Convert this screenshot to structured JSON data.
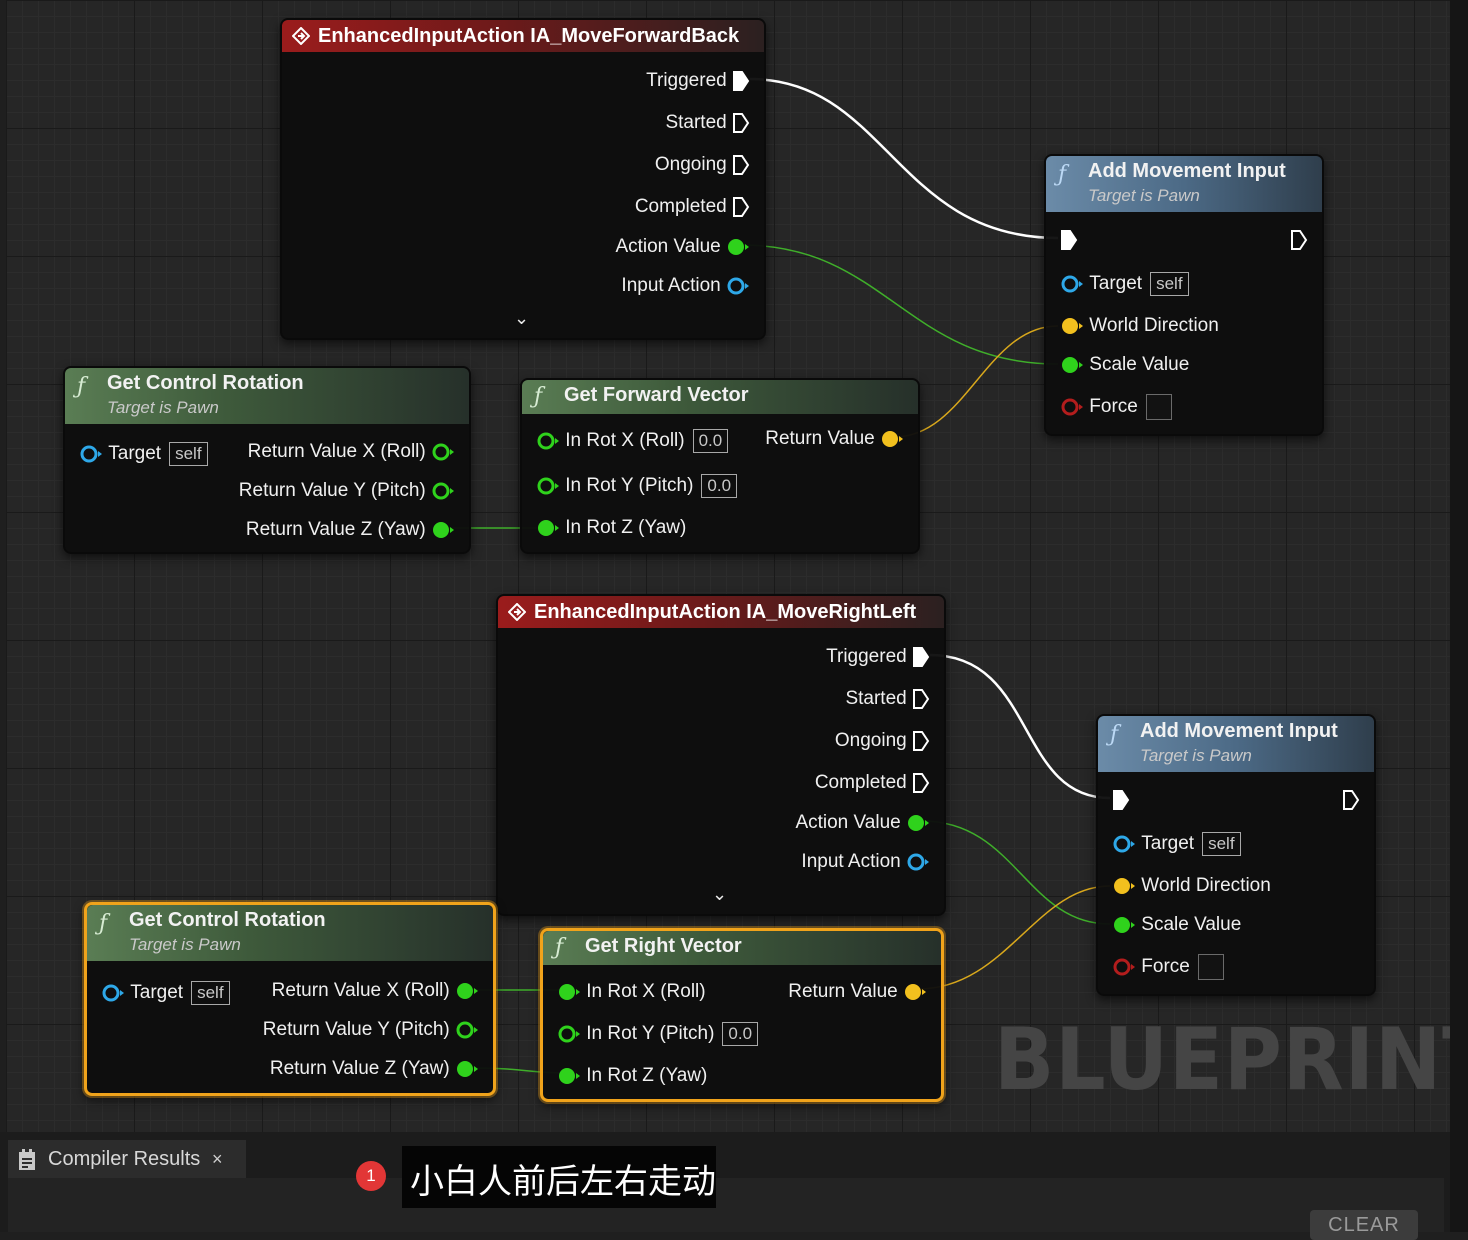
{
  "watermark": "BLUEPRINT",
  "nodes": {
    "ia_forward": {
      "title": "EnhancedInputAction IA_MoveForwardBack",
      "pins": [
        "Triggered",
        "Started",
        "Ongoing",
        "Completed",
        "Action Value",
        "Input Action"
      ]
    },
    "add_move_1": {
      "title": "Add Movement Input",
      "subtitle": "Target is Pawn",
      "target": "Target",
      "target_default": "self",
      "world_direction": "World Direction",
      "scale_value": "Scale Value",
      "force": "Force"
    },
    "get_ctrl_rot_1": {
      "title": "Get Control Rotation",
      "subtitle": "Target is Pawn",
      "target": "Target",
      "target_default": "self",
      "ret_x": "Return Value X (Roll)",
      "ret_y": "Return Value Y (Pitch)",
      "ret_z": "Return Value Z (Yaw)"
    },
    "get_fwd": {
      "title": "Get Forward Vector",
      "in_x": "In Rot X (Roll)",
      "in_x_default": "0.0",
      "in_y": "In Rot Y (Pitch)",
      "in_y_default": "0.0",
      "in_z": "In Rot Z (Yaw)",
      "ret": "Return Value"
    },
    "ia_right": {
      "title": "EnhancedInputAction IA_MoveRightLeft",
      "pins": [
        "Triggered",
        "Started",
        "Ongoing",
        "Completed",
        "Action Value",
        "Input Action"
      ]
    },
    "add_move_2": {
      "title": "Add Movement Input",
      "subtitle": "Target is Pawn",
      "target": "Target",
      "target_default": "self",
      "world_direction": "World Direction",
      "scale_value": "Scale Value",
      "force": "Force"
    },
    "get_ctrl_rot_2": {
      "title": "Get Control Rotation",
      "subtitle": "Target is Pawn",
      "target": "Target",
      "target_default": "self",
      "ret_x": "Return Value X (Roll)",
      "ret_y": "Return Value Y (Pitch)",
      "ret_z": "Return Value Z (Yaw)"
    },
    "get_right": {
      "title": "Get Right Vector",
      "in_x": "In Rot X (Roll)",
      "in_y": "In Rot Y (Pitch)",
      "in_y_default": "0.0",
      "in_z": "In Rot Z (Yaw)",
      "ret": "Return Value"
    }
  },
  "bottom": {
    "tab_label": "Compiler Results",
    "tab_close": "×",
    "clear_label": "CLEAR"
  },
  "caption": {
    "badge": "1",
    "text": "小白人前后左右走动"
  },
  "colors": {
    "exec": "#ffffff",
    "float": "#2fd21c",
    "vector": "#f2c01e",
    "object": "#2ea8e8",
    "bool": "#b31d1d",
    "selection": "#f0a31b"
  }
}
